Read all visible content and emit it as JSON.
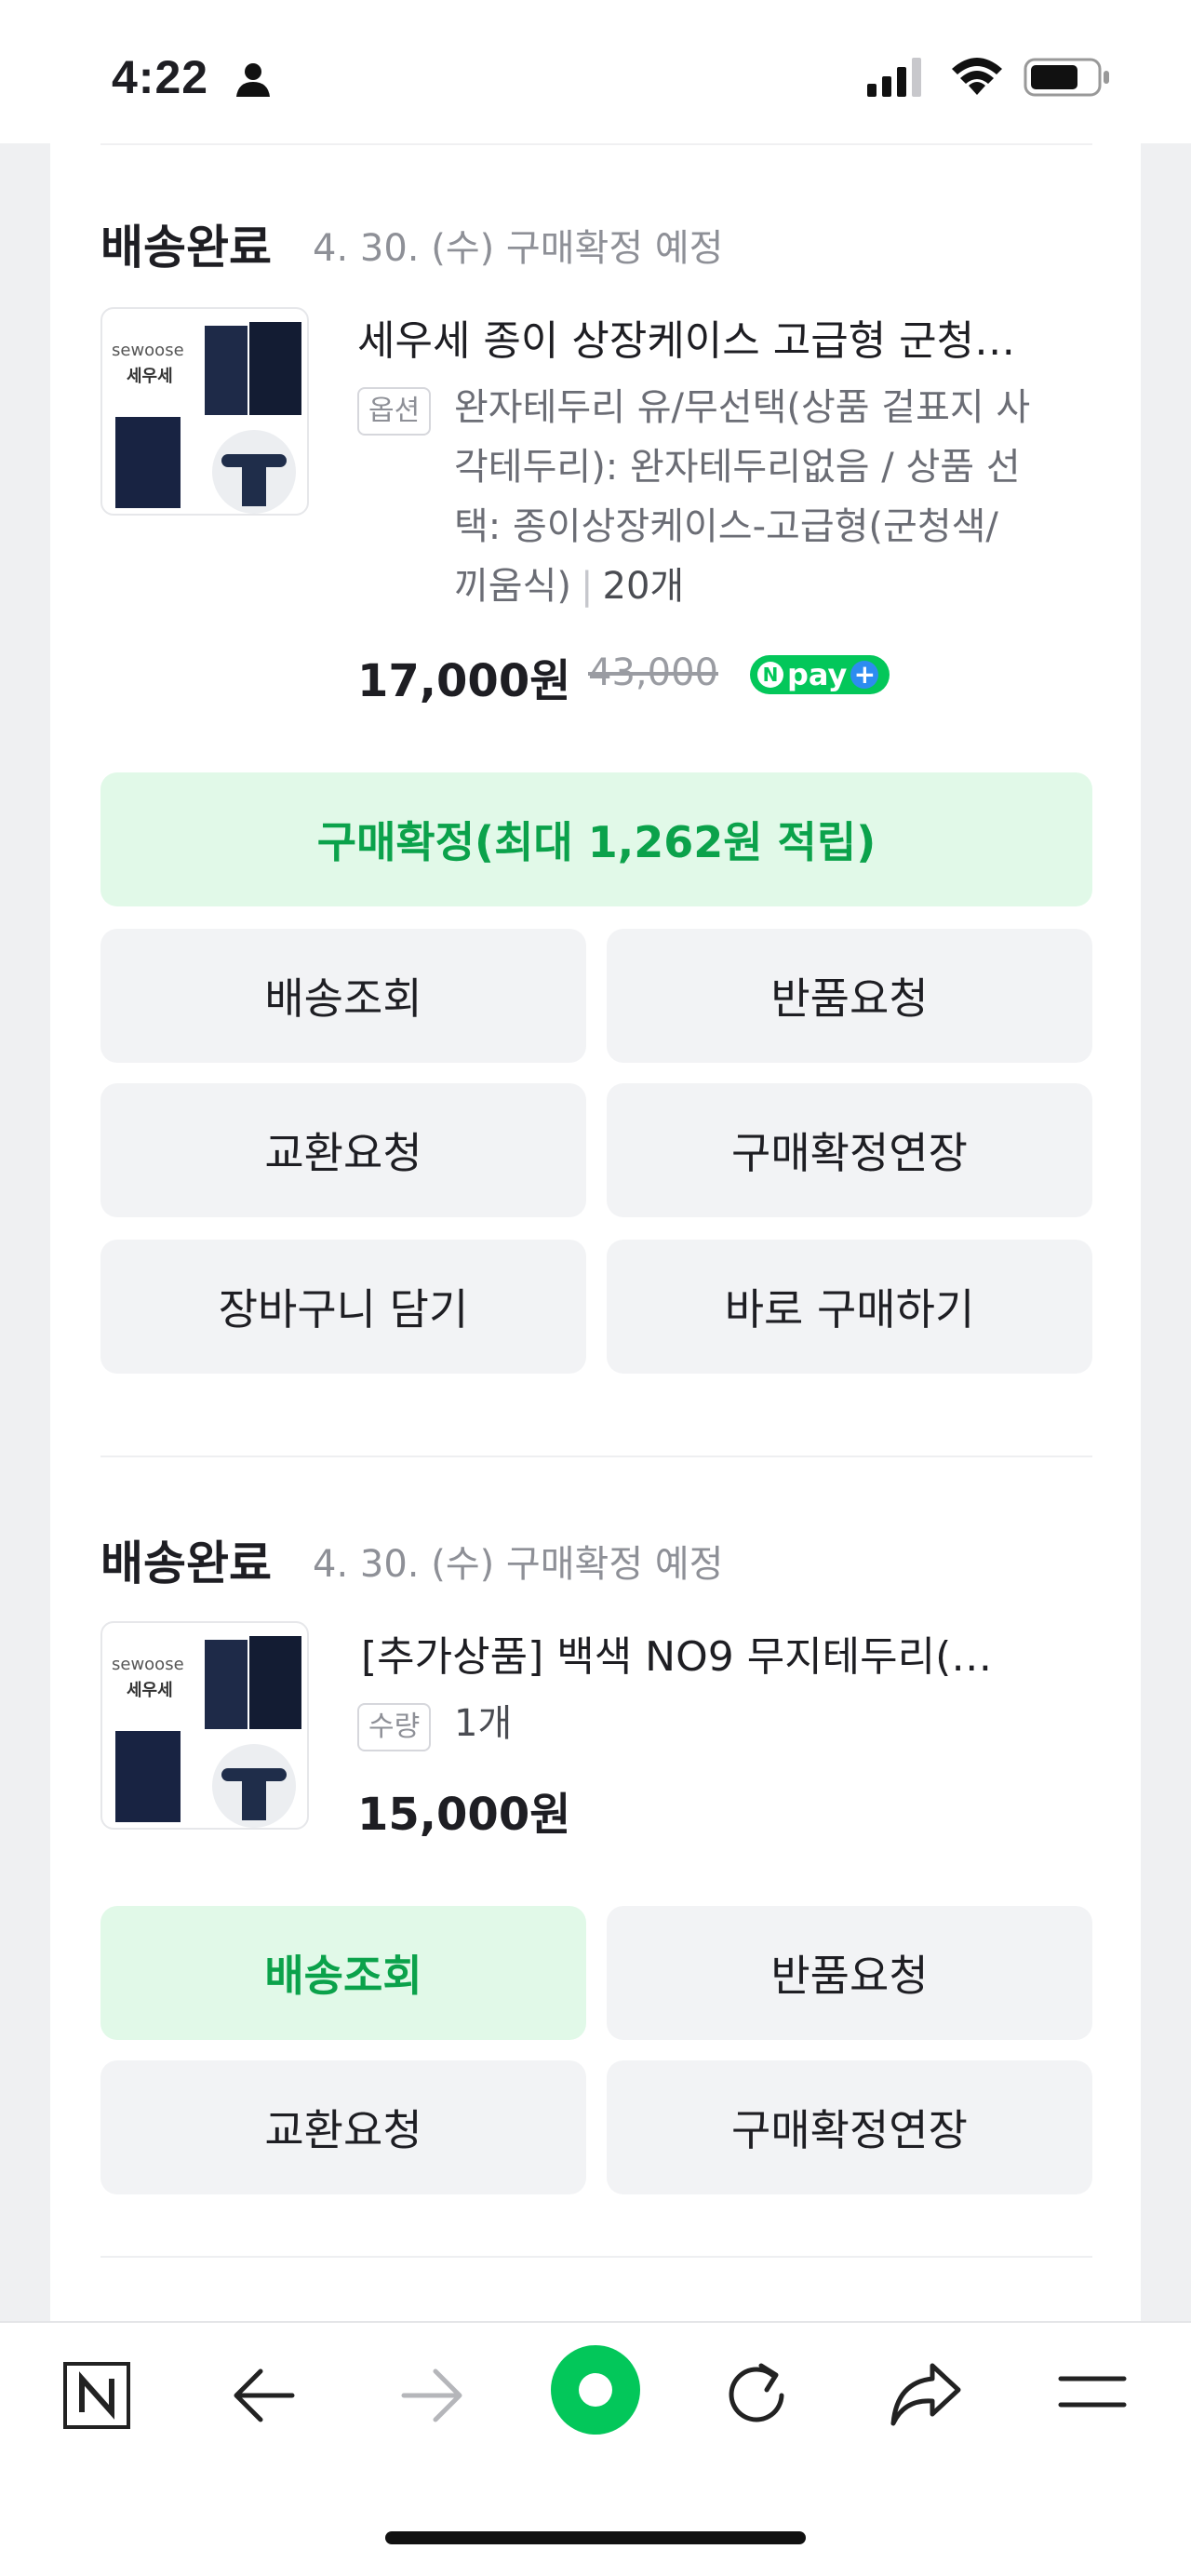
{
  "status_bar": {
    "time": "4:22",
    "icons": [
      "person-icon",
      "cellular-signal-icon",
      "wifi-icon",
      "battery-icon"
    ]
  },
  "orders": [
    {
      "status": "배송완료",
      "date_note": "4. 30. (수) 구매확정 예정",
      "thumbnail": {
        "brand_en": "sewoose",
        "brand_ko": "세우세"
      },
      "title": "세우세 종이 상장케이스 고급형 군청…",
      "option_tag": "옵션",
      "option_lines": [
        "완자테두리 유/무선택(상품 겉표지 사",
        "각테두리): 완자테두리없음 / 상품 선",
        "택: 종이상장케이스-고급형(군청색/",
        "끼움식)"
      ],
      "quantity": "20개",
      "price": "17,000원",
      "original_price": "43,000",
      "npay_label": "pay",
      "buttons": {
        "confirm": "구매확정(최대 1,262원 적립)",
        "track": "배송조회",
        "return": "반품요청",
        "exchange": "교환요청",
        "extend": "구매확정연장",
        "cart": "장바구니 담기",
        "buy_now": "바로 구매하기"
      }
    },
    {
      "status": "배송완료",
      "date_note": "4. 30. (수) 구매확정 예정",
      "thumbnail": {
        "brand_en": "sewoose",
        "brand_ko": "세우세"
      },
      "title": "[추가상품] 백색 NO9 무지테두리(…",
      "quantity_tag": "수량",
      "quantity": "1개",
      "price": "15,000원",
      "buttons": {
        "track": "배송조회",
        "return": "반품요청",
        "exchange": "교환요청",
        "extend": "구매확정연장"
      }
    }
  ],
  "bottom_nav": {
    "items": [
      "naver-n-icon",
      "back-arrow-icon",
      "forward-arrow-icon",
      "home-green-icon",
      "refresh-icon",
      "share-icon",
      "menu-icon"
    ]
  },
  "colors": {
    "accent_green": "#03c75a",
    "button_green_bg": "#e1f9e8",
    "button_green_text": "#0ba24b",
    "button_gray_bg": "#f2f3f5"
  }
}
